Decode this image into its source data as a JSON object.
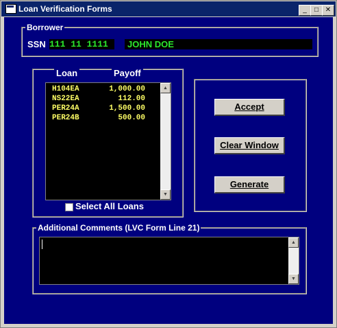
{
  "window": {
    "title": "Loan Verification Forms",
    "controls": {
      "minimize": "_",
      "maximize": "□",
      "close": "✕"
    }
  },
  "borrower": {
    "group_label": "Borrower",
    "ssn_label": "SSN",
    "ssn_value": "111 11 1111",
    "name": "JOHN DOE"
  },
  "loans": {
    "col_loan": "Loan",
    "col_payoff": "Payoff",
    "rows": [
      {
        "loan": "H104EA",
        "payoff": "1,000.00"
      },
      {
        "loan": "NS22EA",
        "payoff": "112.00"
      },
      {
        "loan": "PER24A",
        "payoff": "1,500.00"
      },
      {
        "loan": "PER24B",
        "payoff": "500.00"
      }
    ],
    "select_all_label": "Select All Loans"
  },
  "actions": {
    "accept": "Accept",
    "clear": "Clear Window",
    "generate": "Generate"
  },
  "comments": {
    "group_label": "Additional Comments (LVC Form Line 21)",
    "value": ""
  },
  "colors": {
    "background": "#00007F",
    "field_text_green": "#2CE82C",
    "list_text_yellow": "#FFFF66",
    "titlebar": "#0A246A"
  }
}
